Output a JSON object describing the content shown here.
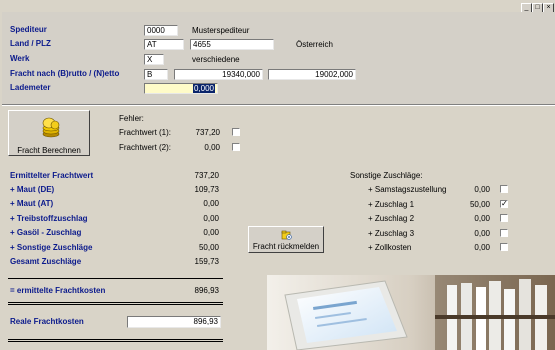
{
  "window": {
    "minimize_label": "_",
    "restore_label": "□",
    "close_label": "×"
  },
  "form": {
    "spediteur": {
      "label": "Spediteur",
      "code": "0000",
      "name": "Musterspediteur"
    },
    "land_plz": {
      "label": "Land / PLZ",
      "land": "AT",
      "plz": "4655",
      "country_name": "Österreich"
    },
    "werk": {
      "label": "Werk",
      "code": "X",
      "name": "verschiedene"
    },
    "fracht": {
      "label": "Fracht nach (B)rutto / (N)etto",
      "mode": "B",
      "brutto": "19340,000",
      "netto": "19002,000"
    },
    "lademeter": {
      "label": "Lademeter",
      "value": "0,000"
    }
  },
  "calc_button_label": "Fracht Berechnen",
  "fehler": {
    "title": "Fehler:",
    "wert1_label": "Frachtwert (1):",
    "wert1_value": "737,20",
    "wert1_checked": false,
    "wert2_label": "Frachtwert (2):",
    "wert2_value": "0,00",
    "wert2_checked": false
  },
  "summary": {
    "rows": [
      {
        "label": "Ermittelter Frachtwert",
        "value": "737,20"
      },
      {
        "label": "+ Maut (DE)",
        "value": "109,73"
      },
      {
        "label": "+ Maut (AT)",
        "value": "0,00"
      },
      {
        "label": "+ Treibstoffzuschlag",
        "value": "0,00"
      },
      {
        "label": "+ Gasöl - Zuschlag",
        "value": "0,00"
      },
      {
        "label": "+ Sonstige Zuschläge",
        "value": "50,00"
      },
      {
        "label": "Gesamt Zuschläge",
        "value": "159,73"
      }
    ],
    "total_label": "= ermittelte Frachtkosten",
    "total_value": "896,93",
    "real_label": "Reale Frachtkosten",
    "real_value": "896,93"
  },
  "report_button_label": "Fracht rückmelden",
  "sonstige": {
    "title": "Sonstige Zuschläge:",
    "rows": [
      {
        "label": "+ Samstagszustellung",
        "value": "0,00",
        "checked": false
      },
      {
        "label": "+ Zuschlag 1",
        "value": "50,00",
        "checked": true
      },
      {
        "label": "+ Zuschlag 2",
        "value": "0,00",
        "checked": false
      },
      {
        "label": "+ Zuschlag 3",
        "value": "0,00",
        "checked": false
      },
      {
        "label": "+ Zollkosten",
        "value": "0,00",
        "checked": false
      }
    ]
  },
  "check_mark": "✓"
}
